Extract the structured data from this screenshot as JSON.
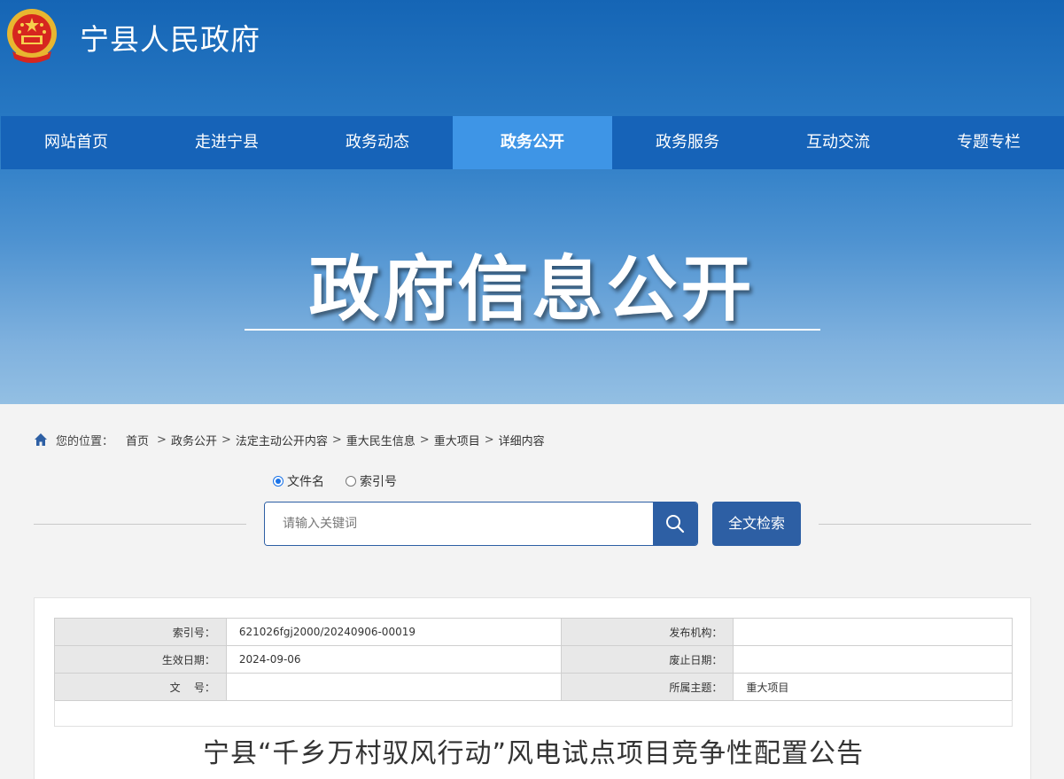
{
  "header": {
    "site_title": "宁县人民政府",
    "banner_title": "政府信息公开"
  },
  "nav": {
    "items": [
      {
        "label": "网站首页"
      },
      {
        "label": "走进宁县"
      },
      {
        "label": "政务动态"
      },
      {
        "label": "政务公开",
        "active": true
      },
      {
        "label": "政务服务"
      },
      {
        "label": "互动交流"
      },
      {
        "label": "专题专栏"
      }
    ]
  },
  "breadcrumb": {
    "label": "您的位置：",
    "items": [
      "首页",
      "政务公开",
      "法定主动公开内容",
      "重大民生信息",
      "重大项目",
      "详细内容"
    ],
    "separator": ">"
  },
  "search": {
    "radio_filename": "文件名",
    "radio_index": "索引号",
    "selected": "文件名",
    "placeholder": "请输入关键词",
    "value": "",
    "fulltext_label": "全文检索"
  },
  "meta": {
    "index_label": "索引号：",
    "index_value": "621026fgj2000/20240906-00019",
    "publisher_label": "发布机构：",
    "publisher_value": "",
    "effective_label": "生效日期：",
    "effective_value": "2024-09-06",
    "expire_label": "废止日期：",
    "expire_value": "",
    "docno_label": "文    号：",
    "docno_value": "",
    "topic_label": "所属主题：",
    "topic_value": "重大项目"
  },
  "document": {
    "title": "宁县“千乡万村驭风行动”风电试点项目竞争性配置公告"
  },
  "colors": {
    "nav_bg": "#1663b8",
    "nav_active": "#3e95e6",
    "button_bg": "#2d5fa4"
  }
}
